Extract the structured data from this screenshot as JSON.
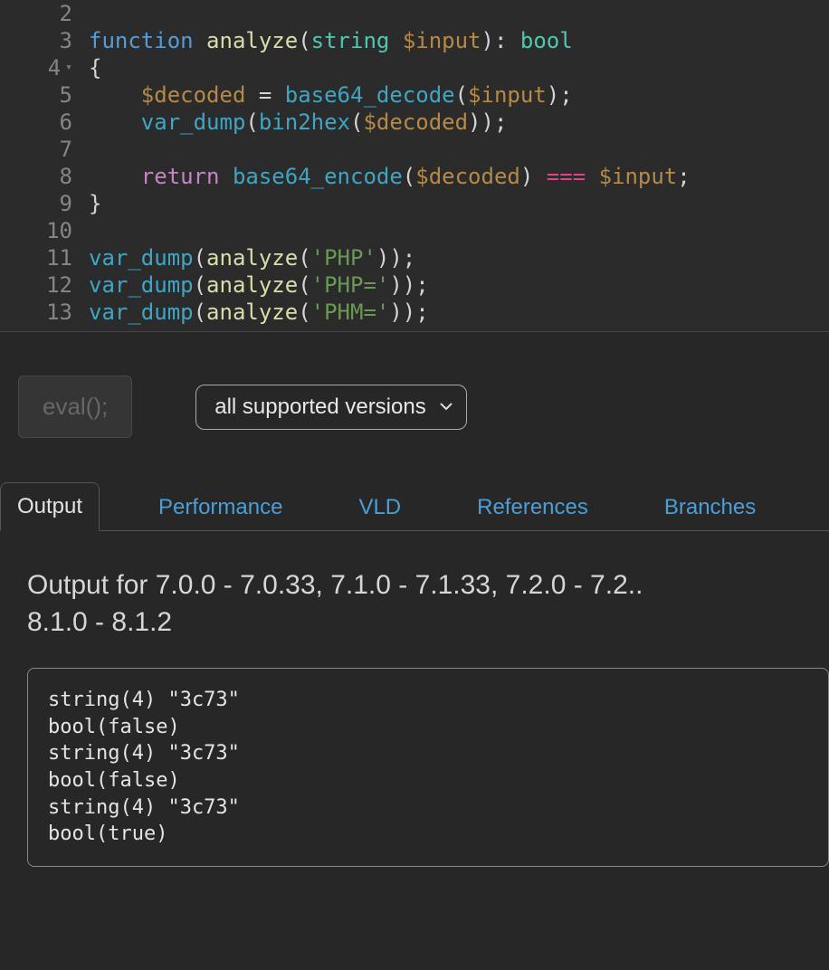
{
  "editor": {
    "lines": [
      {
        "n": "2",
        "fold": false,
        "tokens": []
      },
      {
        "n": "3",
        "fold": false,
        "tokens": [
          [
            "kw-func",
            "function "
          ],
          [
            "fnname",
            "analyze"
          ],
          [
            "punct",
            "("
          ],
          [
            "type",
            "string "
          ],
          [
            "var",
            "$input"
          ],
          [
            "punct",
            "): "
          ],
          [
            "type",
            "bool"
          ]
        ]
      },
      {
        "n": "4",
        "fold": true,
        "tokens": [
          [
            "punct",
            "{"
          ]
        ]
      },
      {
        "n": "5",
        "fold": false,
        "tokens": [
          [
            "punct",
            "    "
          ],
          [
            "var",
            "$decoded"
          ],
          [
            "op",
            " = "
          ],
          [
            "fncall",
            "base64_decode"
          ],
          [
            "punct",
            "("
          ],
          [
            "var",
            "$input"
          ],
          [
            "punct",
            ");"
          ]
        ]
      },
      {
        "n": "6",
        "fold": false,
        "tokens": [
          [
            "punct",
            "    "
          ],
          [
            "fncall",
            "var_dump"
          ],
          [
            "punct",
            "("
          ],
          [
            "fncall",
            "bin2hex"
          ],
          [
            "punct",
            "("
          ],
          [
            "var",
            "$decoded"
          ],
          [
            "punct",
            "));"
          ]
        ]
      },
      {
        "n": "7",
        "fold": false,
        "tokens": []
      },
      {
        "n": "8",
        "fold": false,
        "tokens": [
          [
            "punct",
            "    "
          ],
          [
            "kw-ret",
            "return "
          ],
          [
            "fncall",
            "base64_encode"
          ],
          [
            "punct",
            "("
          ],
          [
            "var",
            "$decoded"
          ],
          [
            "punct",
            ") "
          ],
          [
            "opeq",
            "==="
          ],
          [
            "punct",
            " "
          ],
          [
            "var",
            "$input"
          ],
          [
            "punct",
            ";"
          ]
        ]
      },
      {
        "n": "9",
        "fold": false,
        "tokens": [
          [
            "punct",
            "}"
          ]
        ]
      },
      {
        "n": "10",
        "fold": false,
        "tokens": []
      },
      {
        "n": "11",
        "fold": false,
        "tokens": [
          [
            "fncall",
            "var_dump"
          ],
          [
            "punct",
            "("
          ],
          [
            "fnname",
            "analyze"
          ],
          [
            "punct",
            "("
          ],
          [
            "str",
            "'PHP'"
          ],
          [
            "punct",
            "));"
          ]
        ]
      },
      {
        "n": "12",
        "fold": false,
        "tokens": [
          [
            "fncall",
            "var_dump"
          ],
          [
            "punct",
            "("
          ],
          [
            "fnname",
            "analyze"
          ],
          [
            "punct",
            "("
          ],
          [
            "str",
            "'PHP='"
          ],
          [
            "punct",
            "));"
          ]
        ]
      },
      {
        "n": "13",
        "fold": false,
        "tokens": [
          [
            "fncall",
            "var_dump"
          ],
          [
            "punct",
            "("
          ],
          [
            "fnname",
            "analyze"
          ],
          [
            "punct",
            "("
          ],
          [
            "str",
            "'PHM='"
          ],
          [
            "punct",
            "));"
          ]
        ]
      }
    ]
  },
  "controls": {
    "eval_label": "eval();",
    "version_selected": "all supported versions"
  },
  "tabs": [
    {
      "label": "Output",
      "active": true
    },
    {
      "label": "Performance",
      "active": false
    },
    {
      "label": "VLD",
      "active": false
    },
    {
      "label": "References",
      "active": false
    },
    {
      "label": "Branches",
      "active": false
    }
  ],
  "output": {
    "heading": "Output for 7.0.0 - 7.0.33, 7.1.0 - 7.1.33, 7.2.0 - 7.2., 8.1.0 - 8.1.2",
    "text": "string(4) \"3c73\"\nbool(false)\nstring(4) \"3c73\"\nbool(false)\nstring(4) \"3c73\"\nbool(true)"
  }
}
